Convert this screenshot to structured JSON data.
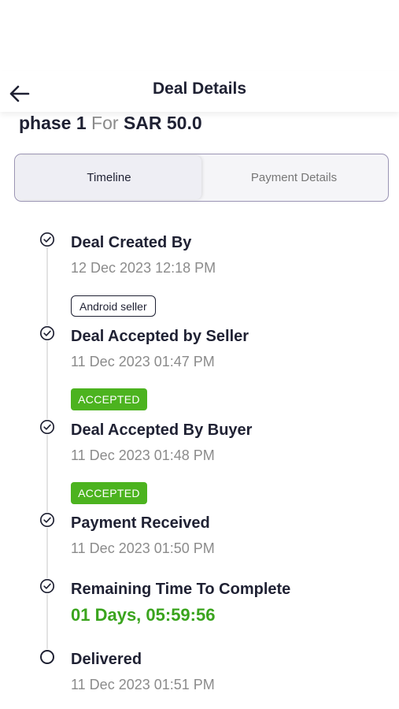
{
  "header": {
    "title": "Deal Details",
    "back_icon": "arrow-left-icon"
  },
  "deal": {
    "phase": "phase 1",
    "for_word": "For",
    "amount": "SAR 50.0"
  },
  "tabs": [
    {
      "label": "Timeline",
      "active": true
    },
    {
      "label": "Payment Details",
      "active": false
    }
  ],
  "timeline": [
    {
      "title": "Deal Created By",
      "date": "12 Dec 2023 12:18 PM",
      "icon": "check-circle-icon",
      "tag": "Android seller"
    },
    {
      "title": "Deal Accepted by Seller",
      "date": "11 Dec 2023 01:47 PM",
      "icon": "check-circle-icon",
      "badge": "ACCEPTED"
    },
    {
      "title": "Deal Accepted By Buyer",
      "date": "11 Dec 2023 01:48 PM",
      "icon": "check-circle-icon",
      "badge": "ACCEPTED"
    },
    {
      "title": "Payment Received",
      "date": "11 Dec 2023 01:50 PM",
      "icon": "check-circle-icon"
    },
    {
      "title": "Remaining Time To Complete",
      "remaining": "01 Days, 05:59:56",
      "icon": "check-circle-icon"
    },
    {
      "title": "Delivered",
      "date": "11 Dec 2023 01:51 PM",
      "icon": "empty-circle-icon"
    }
  ],
  "colors": {
    "accent_green": "#4cb31f",
    "remaining_green": "#3aa41d",
    "text_dark": "#1f2133",
    "text_muted": "#8b8b8b"
  }
}
